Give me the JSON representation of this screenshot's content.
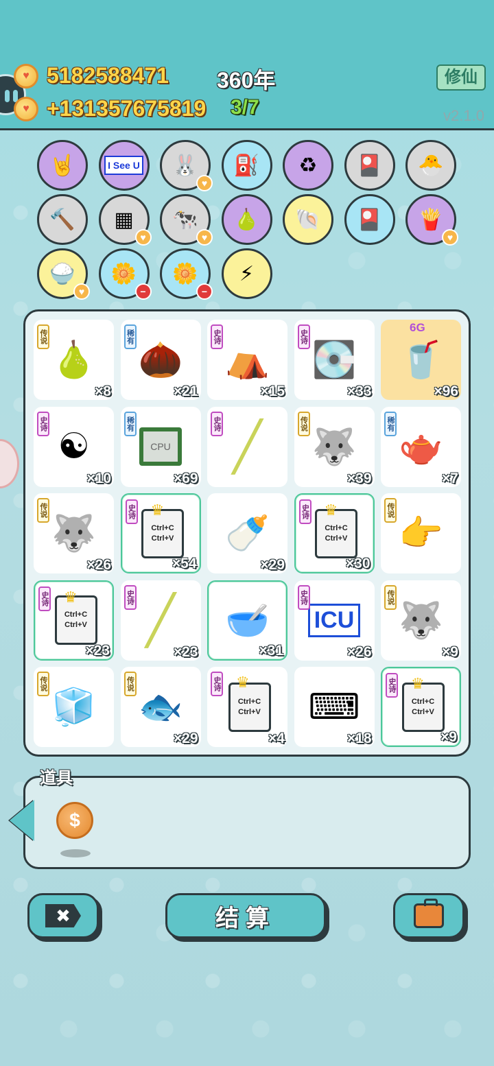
{
  "header": {
    "coins": "5182588471",
    "income": "+131357675819",
    "year": "360年",
    "progress": "3/7",
    "cultivate_label": "修仙",
    "version": "v2.1.0"
  },
  "skills": [
    {
      "name": "rock-hand-icon",
      "color": "purple",
      "glyph": "🤘"
    },
    {
      "name": "i-see-u-icon",
      "color": "purple",
      "glyph": "I See U"
    },
    {
      "name": "rabbit-icon",
      "color": "gray",
      "glyph": "🐰",
      "mark": "heart"
    },
    {
      "name": "pump-icon",
      "color": "blue",
      "glyph": "⛽"
    },
    {
      "name": "recycle-icon",
      "color": "purple",
      "glyph": "♻"
    },
    {
      "name": "card-pack-icon",
      "color": "gray",
      "glyph": "🎴"
    },
    {
      "name": "chick-egg-icon",
      "color": "gray",
      "glyph": "🐣"
    },
    {
      "name": "hammer-icon",
      "color": "gray",
      "glyph": "🔨"
    },
    {
      "name": "tofu-icon",
      "color": "gray",
      "glyph": "▦",
      "mark": "heart"
    },
    {
      "name": "cows-icon",
      "color": "gray",
      "glyph": "🐄",
      "mark": "heart"
    },
    {
      "name": "pomelo-icon",
      "color": "purple",
      "glyph": "🍐"
    },
    {
      "name": "shell-icon",
      "color": "yellow",
      "glyph": "🐚"
    },
    {
      "name": "card-pack-icon",
      "color": "blue",
      "glyph": "🎴"
    },
    {
      "name": "fries-icon",
      "color": "purple",
      "glyph": "🍟",
      "mark": "heart"
    },
    {
      "name": "rice-bowl-icon",
      "color": "yellow",
      "glyph": "🍚",
      "mark": "heart"
    },
    {
      "name": "flower-pot-icon",
      "color": "blue",
      "glyph": "🌼",
      "mark": "minus"
    },
    {
      "name": "flower-pot-icon",
      "color": "blue",
      "glyph": "🌼",
      "mark": "minus"
    },
    {
      "name": "lightning-icon",
      "color": "yellow",
      "glyph": "⚡"
    }
  ],
  "inventory": [
    {
      "name": "longan-item",
      "rarity": "传说",
      "rtype": "legend",
      "glyph": "🍐",
      "count": "×8"
    },
    {
      "name": "nut-item",
      "rarity": "稀有",
      "rtype": "rare",
      "glyph": "🌰",
      "count": "×21"
    },
    {
      "name": "rabbit-house-item",
      "rarity": "史诗",
      "rtype": "epic",
      "glyph": "⛺",
      "count": "×15"
    },
    {
      "name": "gpu-item",
      "rarity": "史诗",
      "rtype": "epic",
      "glyph": "💽",
      "count": "×33"
    },
    {
      "name": "bubble-tea-item",
      "rarity": "",
      "rtype": "",
      "glyph": "🥤",
      "count": "×96",
      "gold": true,
      "tag": "6G"
    },
    {
      "name": "bagua-item",
      "rarity": "史诗",
      "rtype": "epic",
      "glyph": "☯",
      "count": "×10"
    },
    {
      "name": "cpu-item",
      "rarity": "稀有",
      "rtype": "rare",
      "glyph": "CPU",
      "count": "×69"
    },
    {
      "name": "straw-item",
      "rarity": "史诗",
      "rtype": "epic",
      "glyph": "╱",
      "count": ""
    },
    {
      "name": "husky-king-item",
      "rarity": "传说",
      "rtype": "legend",
      "glyph": "🐺",
      "count": "×39"
    },
    {
      "name": "teapot-item",
      "rarity": "稀有",
      "rtype": "rare",
      "glyph": "🫖",
      "count": "×7"
    },
    {
      "name": "husky-king-item",
      "rarity": "传说",
      "rtype": "legend",
      "glyph": "🐺",
      "count": "×26"
    },
    {
      "name": "ctrl-cv-item",
      "rarity": "史诗",
      "rtype": "epic",
      "glyph": "ctrl",
      "count": "×54",
      "glow": true
    },
    {
      "name": "milk-bottle-item",
      "rarity": "",
      "rtype": "",
      "glyph": "🍼",
      "count": "×29"
    },
    {
      "name": "ctrl-cv-item",
      "rarity": "史诗",
      "rtype": "epic",
      "glyph": "ctrl",
      "count": "×30",
      "glow": true
    },
    {
      "name": "pointing-hand-item",
      "rarity": "传说",
      "rtype": "legend",
      "glyph": "👉",
      "count": ""
    },
    {
      "name": "ctrl-cv-item",
      "rarity": "史诗",
      "rtype": "epic",
      "glyph": "ctrl",
      "count": "×23",
      "glow": true
    },
    {
      "name": "straw-item",
      "rarity": "史诗",
      "rtype": "epic",
      "glyph": "╱",
      "count": "×23"
    },
    {
      "name": "bowl-item",
      "rarity": "",
      "rtype": "",
      "glyph": "🥣",
      "count": "×31",
      "glow": true
    },
    {
      "name": "icu-item",
      "rarity": "史诗",
      "rtype": "epic",
      "glyph": "ICU",
      "count": "×26"
    },
    {
      "name": "husky-king-item",
      "rarity": "传说",
      "rtype": "legend",
      "glyph": "🐺",
      "count": "×9"
    },
    {
      "name": "fridge-item",
      "rarity": "传说",
      "rtype": "legend",
      "glyph": "🧊",
      "count": ""
    },
    {
      "name": "koi-item",
      "rarity": "传说",
      "rtype": "legend",
      "glyph": "🐟",
      "count": "×29"
    },
    {
      "name": "ctrl-cv-item",
      "rarity": "史诗",
      "rtype": "epic",
      "glyph": "ctrl",
      "count": "×4"
    },
    {
      "name": "keyboard-item",
      "rarity": "",
      "rtype": "",
      "glyph": "⌨",
      "count": "×18"
    },
    {
      "name": "ctrl-cv-item",
      "rarity": "史诗",
      "rtype": "epic",
      "glyph": "ctrl",
      "count": "×9",
      "glow": true
    }
  ],
  "ctrl_text": "Ctrl+C\nCtrl+V",
  "props": {
    "title": "道具",
    "coin_symbol": "$"
  },
  "buttons": {
    "close_symbol": "✖",
    "settle_label": "结算"
  }
}
